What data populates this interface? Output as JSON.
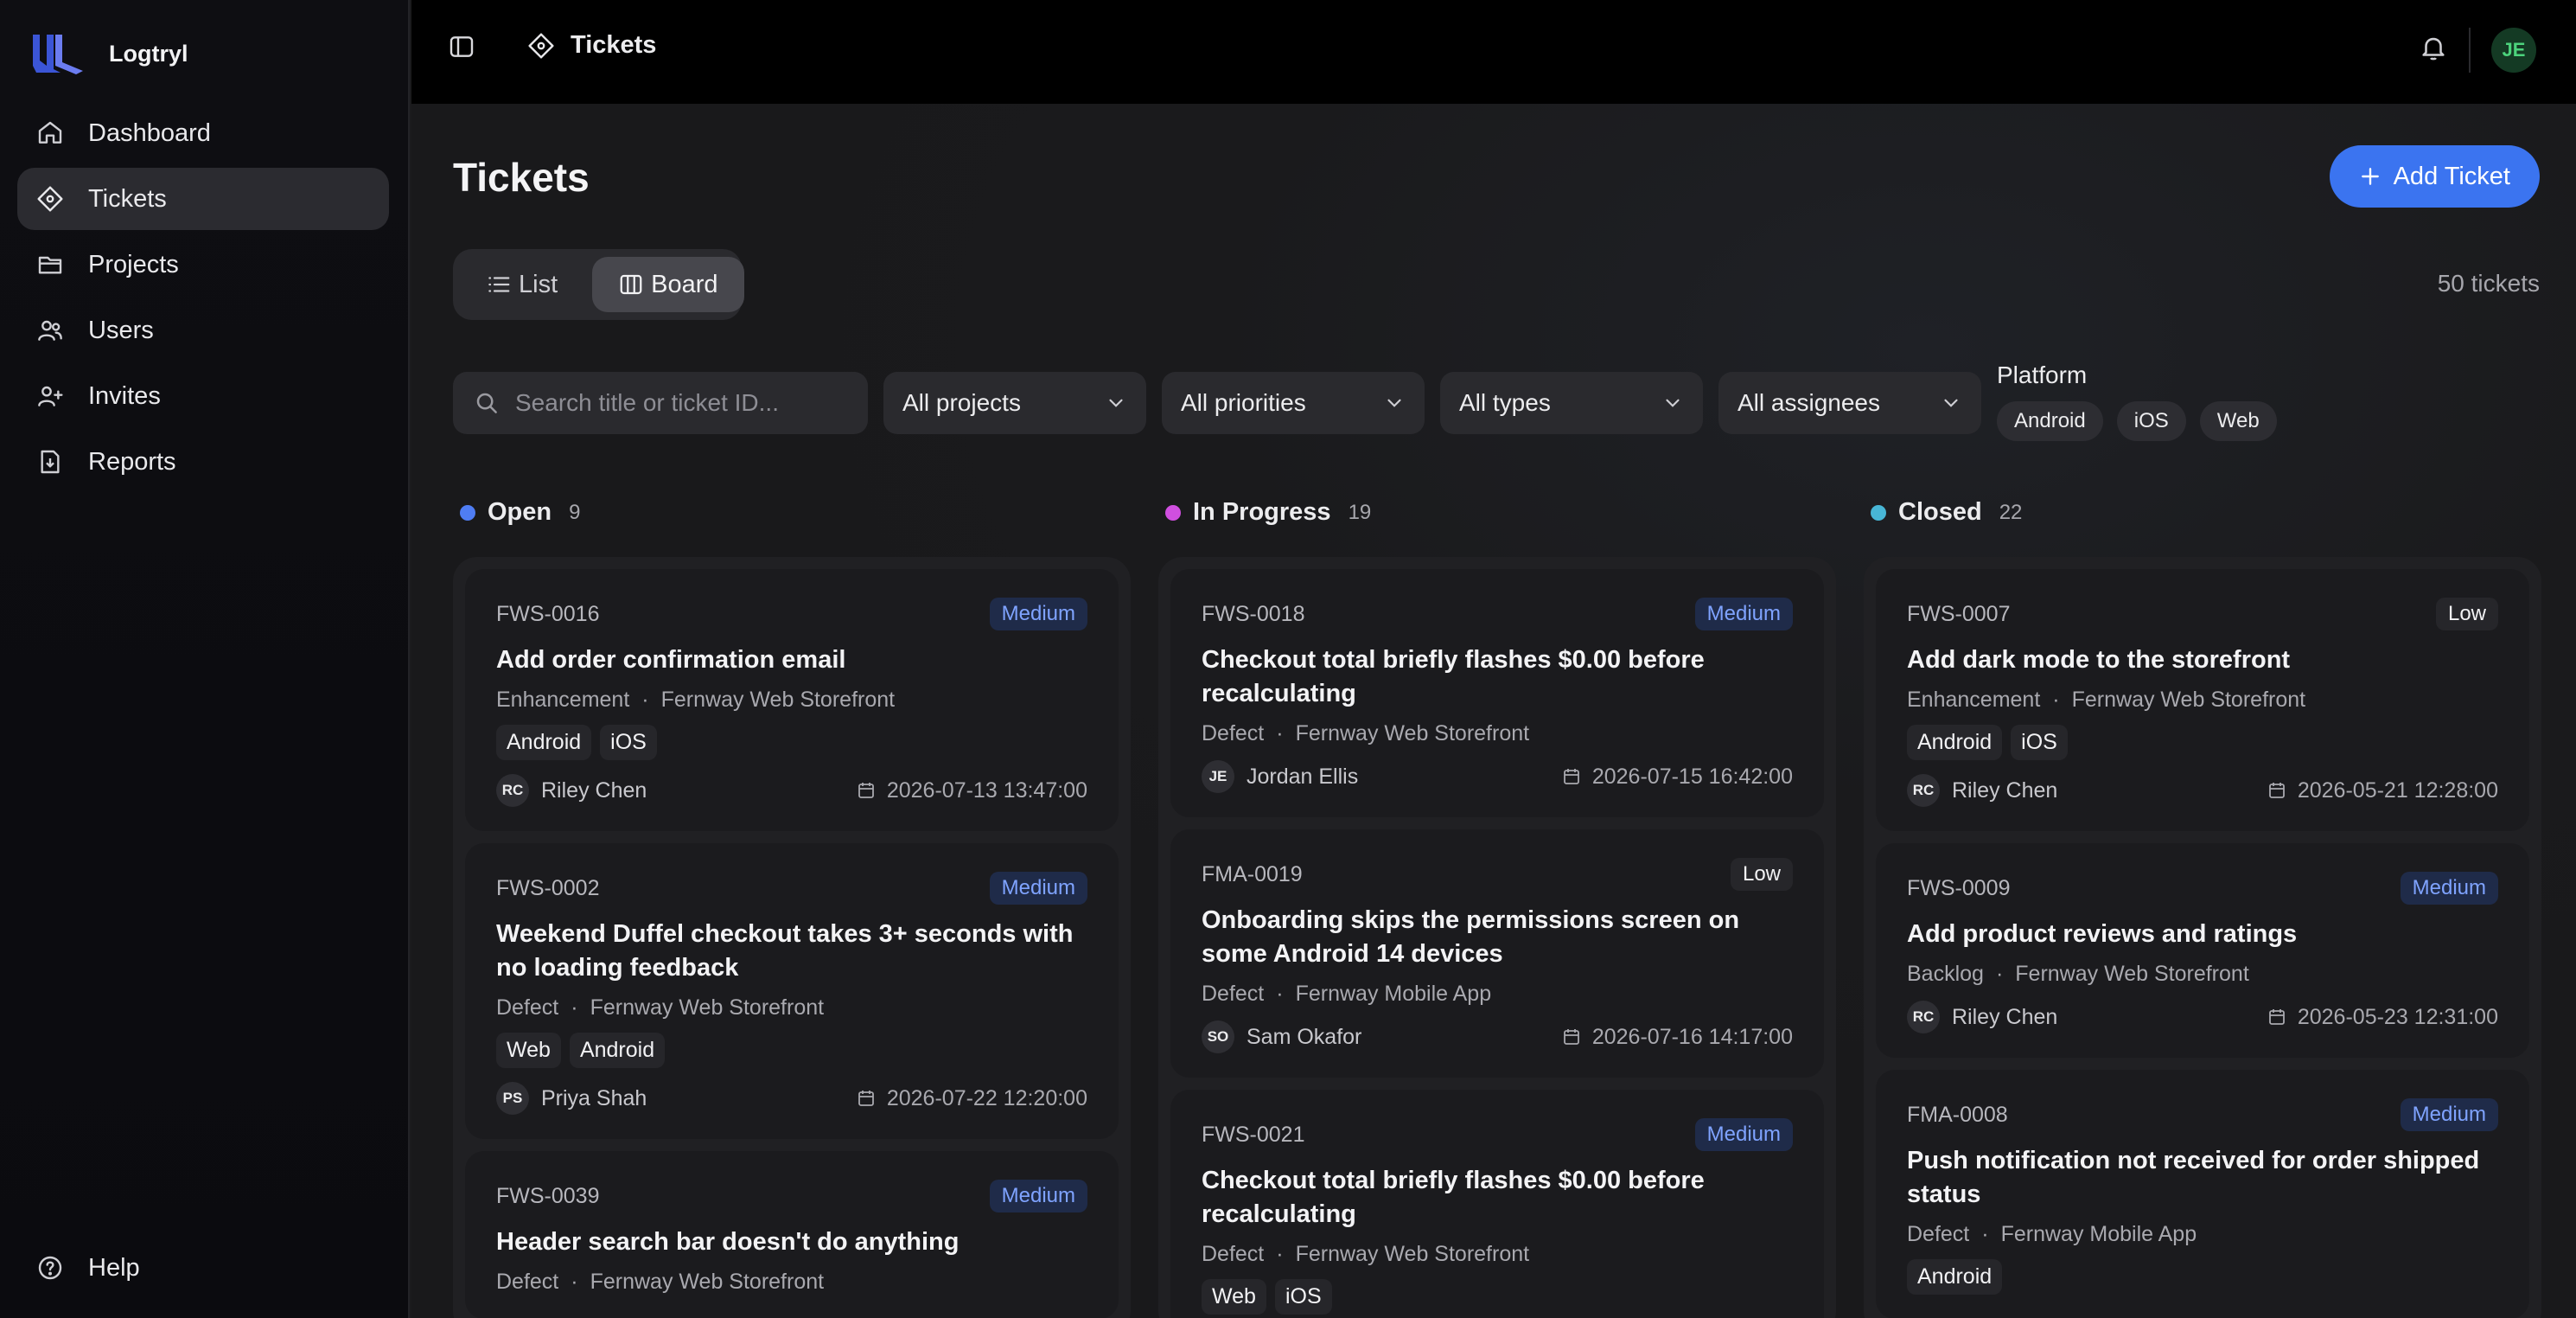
{
  "app": {
    "name": "Logtryl"
  },
  "sidebar": {
    "items": [
      {
        "label": "Dashboard",
        "icon": "home-icon"
      },
      {
        "label": "Tickets",
        "icon": "ticket-icon",
        "active": true
      },
      {
        "label": "Projects",
        "icon": "folder-icon"
      },
      {
        "label": "Users",
        "icon": "users-icon"
      },
      {
        "label": "Invites",
        "icon": "user-plus-icon"
      },
      {
        "label": "Reports",
        "icon": "report-icon"
      }
    ],
    "help": "Help"
  },
  "topbar": {
    "crumb": "Tickets",
    "avatar": "JE"
  },
  "page": {
    "title": "Tickets",
    "add_button": "Add Ticket",
    "count": "50 tickets",
    "views": {
      "list": "List",
      "board": "Board"
    }
  },
  "filters": {
    "search_placeholder": "Search title or ticket ID...",
    "projects": "All projects",
    "priorities": "All priorities",
    "types": "All types",
    "assignees": "All assignees",
    "platform_label": "Platform",
    "platforms": [
      "Android",
      "iOS",
      "Web"
    ]
  },
  "colors": {
    "open": "#4f7df3",
    "in_progress": "#d04fe0",
    "closed": "#48b6d6",
    "accent": "#3b74f0"
  },
  "columns": [
    {
      "name": "Open",
      "count": "9",
      "cards": [
        {
          "id": "FWS-0016",
          "priority": "Medium",
          "title": "Add order confirmation email",
          "type": "Enhancement",
          "project": "Fernway Web Storefront",
          "tags": [
            "Android",
            "iOS"
          ],
          "initials": "RC",
          "assignee": "Riley Chen",
          "date": "2026-07-13 13:47:00"
        },
        {
          "id": "FWS-0002",
          "priority": "Medium",
          "title": "Weekend Duffel checkout takes 3+ seconds with no loading feedback",
          "type": "Defect",
          "project": "Fernway Web Storefront",
          "tags": [
            "Web",
            "Android"
          ],
          "initials": "PS",
          "assignee": "Priya Shah",
          "date": "2026-07-22 12:20:00"
        },
        {
          "id": "FWS-0039",
          "priority": "Medium",
          "title": "Header search bar doesn't do anything",
          "type": "Defect",
          "project": "Fernway Web Storefront",
          "tags": [],
          "initials": "",
          "assignee": "",
          "date": ""
        }
      ]
    },
    {
      "name": "In Progress",
      "count": "19",
      "cards": [
        {
          "id": "FWS-0018",
          "priority": "Medium",
          "title": "Checkout total briefly flashes $0.00 before recalculating",
          "type": "Defect",
          "project": "Fernway Web Storefront",
          "tags": [],
          "initials": "JE",
          "assignee": "Jordan Ellis",
          "date": "2026-07-15 16:42:00"
        },
        {
          "id": "FMA-0019",
          "priority": "Low",
          "title": "Onboarding skips the permissions screen on some Android 14 devices",
          "type": "Defect",
          "project": "Fernway Mobile App",
          "tags": [],
          "initials": "SO",
          "assignee": "Sam Okafor",
          "date": "2026-07-16 14:17:00"
        },
        {
          "id": "FWS-0021",
          "priority": "Medium",
          "title": "Checkout total briefly flashes $0.00 before recalculating",
          "type": "Defect",
          "project": "Fernway Web Storefront",
          "tags": [
            "Web",
            "iOS"
          ],
          "initials": "",
          "assignee": "",
          "date": ""
        }
      ]
    },
    {
      "name": "Closed",
      "count": "22",
      "cards": [
        {
          "id": "FWS-0007",
          "priority": "Low",
          "title": "Add dark mode to the storefront",
          "type": "Enhancement",
          "project": "Fernway Web Storefront",
          "tags": [
            "Android",
            "iOS"
          ],
          "initials": "RC",
          "assignee": "Riley Chen",
          "date": "2026-05-21 12:28:00"
        },
        {
          "id": "FWS-0009",
          "priority": "Medium",
          "title": "Add product reviews and ratings",
          "type": "Backlog",
          "project": "Fernway Web Storefront",
          "tags": [],
          "initials": "RC",
          "assignee": "Riley Chen",
          "date": "2026-05-23 12:31:00"
        },
        {
          "id": "FMA-0008",
          "priority": "Medium",
          "title": "Push notification not received for order shipped status",
          "type": "Defect",
          "project": "Fernway Mobile App",
          "tags": [
            "Android"
          ],
          "initials": "",
          "assignee": "",
          "date": ""
        }
      ]
    }
  ]
}
